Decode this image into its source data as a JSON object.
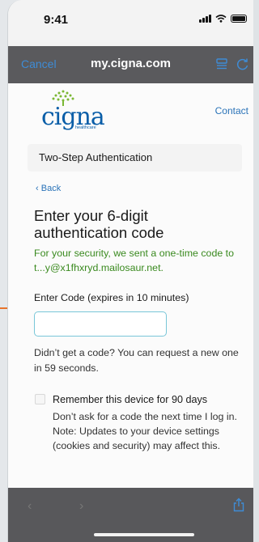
{
  "status": {
    "time": "9:41"
  },
  "browser": {
    "cancel_label": "Cancel",
    "url": "my.cigna.com"
  },
  "header": {
    "logo_word": "cigna",
    "logo_sub": "healthcare",
    "contact_label": "Contact"
  },
  "section": {
    "title": "Two-Step Authentication"
  },
  "form": {
    "back_label": "Back",
    "heading": "Enter your 6-digit authentication code",
    "notice": "For your security, we sent a one-time code to t...y@x1fhxryd.mailosaur.net.",
    "code_label": "Enter Code (expires in 10 minutes)",
    "code_value": "",
    "resend_text": "Didn’t get a code? You can request a new one in 59 seconds.",
    "remember_label": "Remember this device for 90 days",
    "remember_desc": "Don’t ask for a code the next time I log in. Note: Updates to your device settings (cookies and security) may affect this.",
    "remember_checked": false
  },
  "colors": {
    "brand_blue": "#0a5ea8",
    "link_blue": "#2a73b8",
    "notice_green": "#3a8a1f",
    "input_border": "#79c6d8",
    "toolbar_gray": "#5a5a5d",
    "cancel_blue": "#3e8cd6",
    "accent_orange": "#e8742b"
  },
  "icons": {
    "toolbar_left": "reader-view-icon",
    "toolbar_right": "reload-icon",
    "bottom_right": "share-icon",
    "bottom_left": "back-arrow-icon",
    "bottom_forward": "forward-arrow-icon"
  }
}
